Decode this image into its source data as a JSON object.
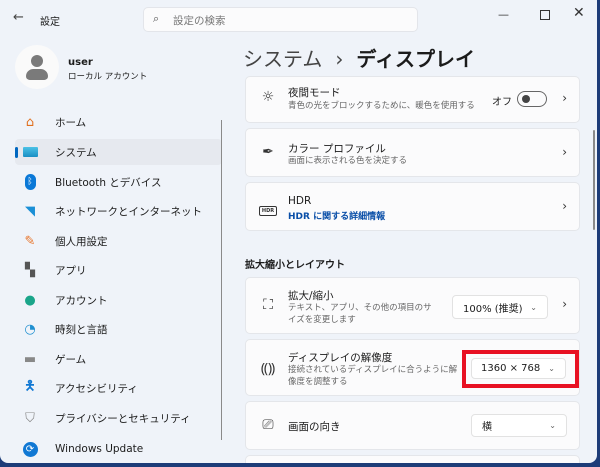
{
  "titlebar": {
    "app_title": "設定",
    "search_placeholder": "設定の検索"
  },
  "user": {
    "name": "user",
    "account_type": "ローカル アカウント"
  },
  "sidebar": {
    "items": [
      {
        "label": "ホーム",
        "icon": "home-icon"
      },
      {
        "label": "システム",
        "icon": "system-icon",
        "selected": true
      },
      {
        "label": "Bluetooth とデバイス",
        "icon": "bluetooth-icon"
      },
      {
        "label": "ネットワークとインターネット",
        "icon": "wifi-icon"
      },
      {
        "label": "個人用設定",
        "icon": "brush-icon"
      },
      {
        "label": "アプリ",
        "icon": "apps-icon"
      },
      {
        "label": "アカウント",
        "icon": "account-icon"
      },
      {
        "label": "時刻と言語",
        "icon": "clock-globe-icon"
      },
      {
        "label": "ゲーム",
        "icon": "gamepad-icon"
      },
      {
        "label": "アクセシビリティ",
        "icon": "accessibility-icon"
      },
      {
        "label": "プライバシーとセキュリティ",
        "icon": "shield-icon"
      },
      {
        "label": "Windows Update",
        "icon": "update-icon"
      }
    ]
  },
  "breadcrumb": {
    "parent": "システム",
    "separator": "›",
    "current": "ディスプレイ"
  },
  "cards": {
    "night": {
      "title": "夜間モード",
      "desc": "青色の光をブロックするために、暖色を使用する",
      "toggle_label": "オフ",
      "toggle_on": false
    },
    "color": {
      "title": "カラー プロファイル",
      "desc": "画面に表示される色を決定する"
    },
    "hdr": {
      "title": "HDR",
      "link": "HDR に関する詳細情報"
    }
  },
  "section": {
    "title": "拡大縮小とレイアウト"
  },
  "layout": {
    "scale": {
      "title": "拡大/縮小",
      "desc": "テキスト、アプリ、その他の項目のサイズを変更します",
      "value": "100% (推奨)"
    },
    "resolution": {
      "title": "ディスプレイの解像度",
      "desc": "接続されているディスプレイに合うように解像度を調整する",
      "value": "1360 × 768"
    },
    "orientation": {
      "title": "画面の向き",
      "value": "横"
    }
  },
  "colors": {
    "accent": "#0067c0",
    "highlight": "#e81123"
  }
}
